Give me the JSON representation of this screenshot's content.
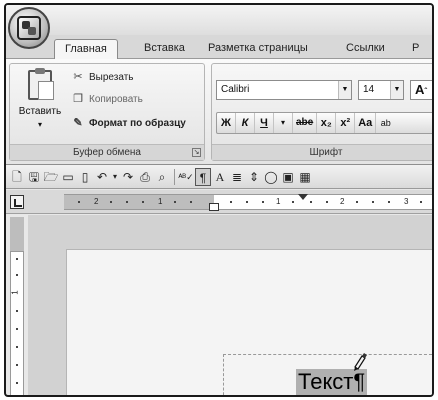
{
  "tabs": [
    "Главная",
    "Вставка",
    "Разметка страницы",
    "Ссылки",
    "Р"
  ],
  "clipboard": {
    "paste_label": "Вставить",
    "cut_label": "Вырезать",
    "copy_label": "Копировать",
    "format_painter_label": "Формат по образцу",
    "group_label": "Буфер обмена"
  },
  "font": {
    "name": "Calibri",
    "size": "14",
    "group_label": "Шрифт",
    "buttons": [
      "Ж",
      "К",
      "Ч",
      "abe",
      "x₂",
      "x²",
      "Aa"
    ]
  },
  "ruler": {
    "numbers": [
      "2",
      "1",
      "1",
      "2",
      "3"
    ]
  },
  "vruler": {
    "numbers": [
      "1"
    ]
  },
  "document": {
    "text": "Текст",
    "pilcrow": "¶"
  },
  "icons": {
    "office_button": "office-logo-icon",
    "cut": "scissors-icon",
    "copy": "copy-icon",
    "format_painter": "brush-icon"
  }
}
